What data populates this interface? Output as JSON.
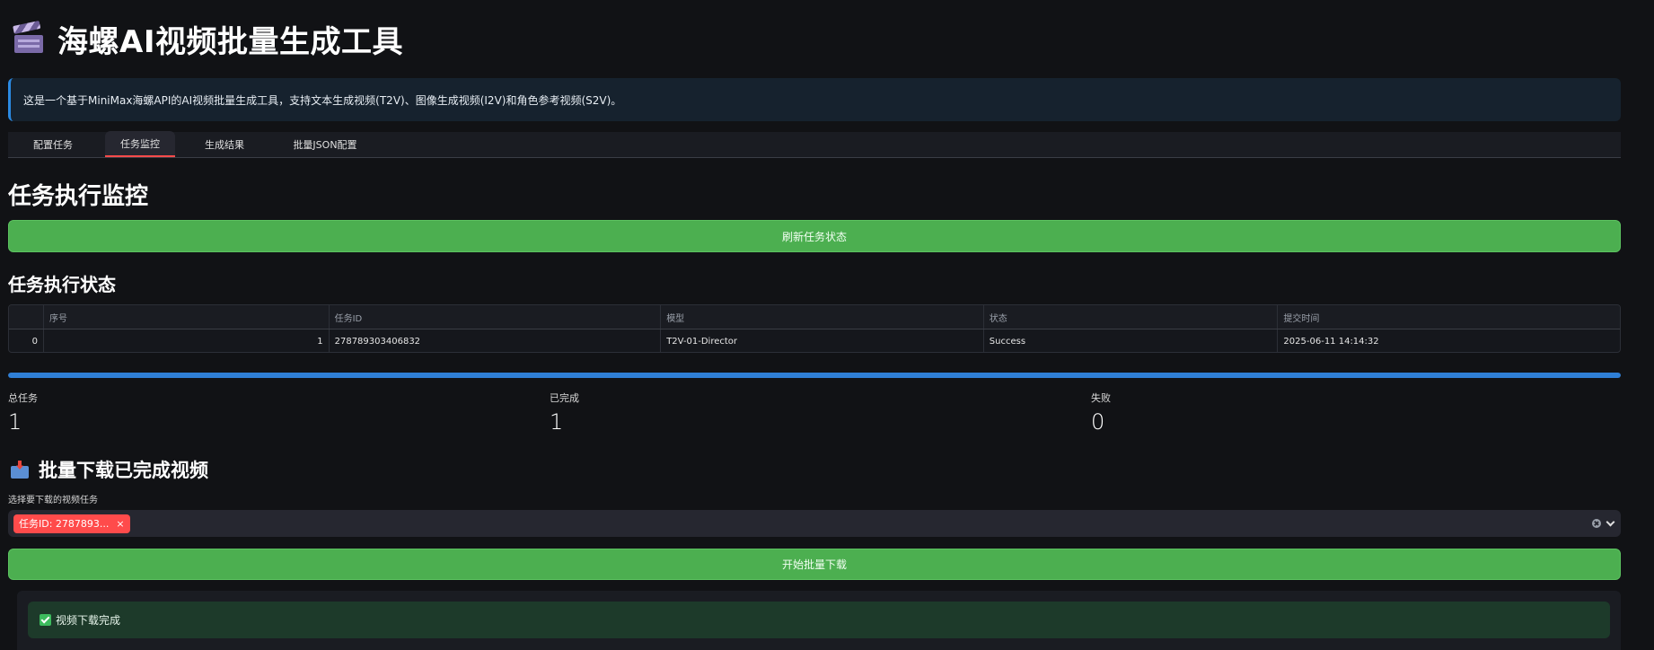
{
  "app": {
    "title": "海螺AI视频批量生成工具",
    "info": "这是一个基于MiniMax海螺API的AI视频批量生成工具，支持文本生成视频(T2V)、图像生成视频(I2V)和角色参考视频(S2V)。"
  },
  "tabs": [
    "配置任务",
    "任务监控",
    "生成结果",
    "批量JSON配置"
  ],
  "monitor": {
    "heading": "任务执行监控",
    "refresh_button": "刷新任务状态",
    "status_heading": "任务执行状态"
  },
  "table": {
    "columns": [
      "",
      "序号",
      "任务ID",
      "模型",
      "状态",
      "提交时间"
    ],
    "rows": [
      [
        "0",
        "1",
        "278789303406832",
        "T2V-01-Director",
        "Success",
        "2025-06-11 14:14:32"
      ]
    ]
  },
  "progress": {
    "fraction": 1.0,
    "color": "#2f7fd6"
  },
  "metrics": {
    "total_label": "总任务",
    "total_value": "1",
    "done_label": "已完成",
    "done_value": "1",
    "failed_label": "失败",
    "failed_value": "0"
  },
  "download": {
    "heading": "批量下载已完成视频",
    "heading_icon": "inbox-tray-icon",
    "select_label": "选择要下载的视频任务",
    "chip": "任务ID: 2787893...",
    "chip_close": "×",
    "button": "开始批量下载",
    "success_message": "视频下载完成"
  },
  "colors": {
    "accent": "#ff4b4b",
    "button_green": "#4caf50",
    "info_border": "#2b8ae2",
    "success_bg": "#1d3a2a"
  }
}
